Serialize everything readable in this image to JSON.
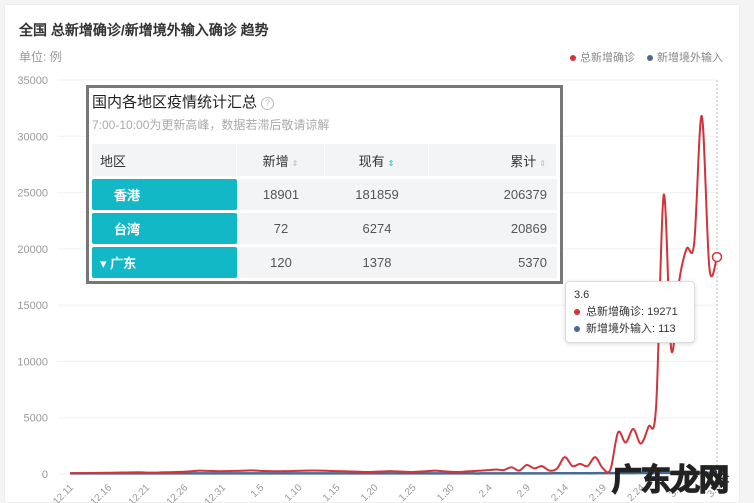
{
  "title": "全国 总新增确诊/新增境外输入确诊 趋势",
  "unit": "单位: 例",
  "colors": {
    "total": "#d0343a",
    "imported": "#4a6a94",
    "accent": "#12b8c6"
  },
  "chart_data": {
    "type": "line",
    "title": "全国 总新增确诊/新增境外输入确诊 趋势",
    "ylabel": "单位: 例",
    "ylim": [
      0,
      35000
    ],
    "yticks": [
      "0",
      "5000",
      "10000",
      "15000",
      "20000",
      "25000",
      "30000",
      "35000"
    ],
    "xticks": [
      "12.11",
      "12.16",
      "12.21",
      "12.26",
      "12.31",
      "1.5",
      "1.10",
      "1.15",
      "1.20",
      "1.25",
      "1.30",
      "2.4",
      "2.9",
      "2.14",
      "2.19",
      "2.24",
      "3.1",
      "3.6"
    ],
    "legend": "top-right",
    "series": [
      {
        "name": "总新增确诊",
        "values": [
          60,
          70,
          80,
          90,
          100,
          110,
          120,
          130,
          140,
          150,
          130,
          120,
          140,
          160,
          180,
          200,
          250,
          300,
          280,
          260,
          250,
          270,
          280,
          300,
          320,
          280,
          260,
          240,
          250,
          260,
          280,
          300,
          310,
          300,
          280,
          260,
          240,
          220,
          200,
          180,
          200,
          220,
          250,
          230,
          200,
          180,
          220,
          250,
          300,
          250,
          200,
          180,
          220,
          260,
          300,
          350,
          400,
          350,
          600,
          300,
          800,
          500,
          700,
          300,
          500,
          1500,
          700,
          900,
          700,
          1500,
          500,
          400,
          3700,
          2800,
          4000,
          2700,
          4200,
          6000,
          24800,
          11000,
          17000,
          20000,
          20500,
          31800,
          18300,
          19271
        ]
      },
      {
        "name": "新增境外输入",
        "values": [
          50,
          50,
          50,
          50,
          50,
          50,
          50,
          50,
          50,
          50,
          50,
          50,
          50,
          50,
          50,
          50,
          50,
          50,
          50,
          50,
          50,
          50,
          50,
          50,
          50,
          50,
          50,
          50,
          50,
          50,
          50,
          50,
          50,
          50,
          50,
          50,
          50,
          50,
          50,
          50,
          50,
          50,
          50,
          50,
          50,
          50,
          50,
          50,
          50,
          50,
          50,
          50,
          50,
          50,
          50,
          60,
          60,
          60,
          60,
          60,
          60,
          60,
          60,
          60,
          70,
          70,
          70,
          70,
          70,
          70,
          80,
          80,
          80,
          80,
          80,
          90,
          90,
          90,
          100,
          100,
          100,
          100,
          110,
          110,
          110,
          113
        ]
      }
    ]
  },
  "panel": {
    "title": "国内各地区疫情统计汇总",
    "help": "?",
    "subtitle": "7:00-10:00为更新高峰，数据若滞后敬请谅解",
    "headers": [
      "地区",
      "新增",
      "现有",
      "累计"
    ],
    "sort_icon": "⇕",
    "rows": [
      {
        "region": "香港",
        "new": "18901",
        "current": "181859",
        "total": "206379"
      },
      {
        "region": "台湾",
        "new": "72",
        "current": "6274",
        "total": "20869"
      },
      {
        "region": "▾ 广东",
        "new": "120",
        "current": "1378",
        "total": "5370"
      }
    ]
  },
  "tooltip": {
    "date": "3.6",
    "total": "总新增确诊: 19271",
    "imported": "新增境外输入: 113"
  },
  "watermark": "广东龙网",
  "watermark_tail": "泽"
}
